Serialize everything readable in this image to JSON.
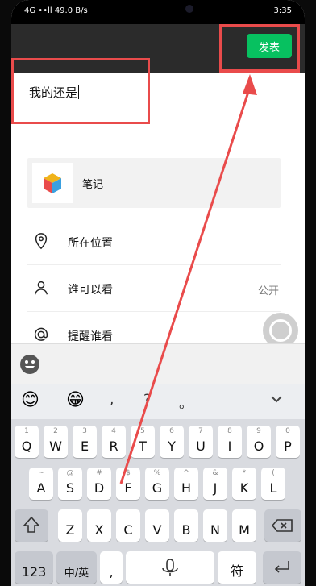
{
  "status": {
    "left": "4G  ••ll  49.0 B/s",
    "right": "3:35"
  },
  "topbar": {
    "post_label": "发表"
  },
  "editor": {
    "text": "我的还是"
  },
  "note": {
    "label": "笔记"
  },
  "options": {
    "location": {
      "label": "所在位置"
    },
    "visibility": {
      "label": "谁可以看",
      "value": "公开"
    },
    "mention": {
      "label": "提醒谁看"
    }
  },
  "keyboard": {
    "top_syms": [
      ",",
      "?",
      "。"
    ],
    "row1": [
      "Q",
      "W",
      "E",
      "R",
      "T",
      "Y",
      "U",
      "I",
      "O",
      "P"
    ],
    "row1_sub": [
      "1",
      "2",
      "3",
      "4",
      "5",
      "6",
      "7",
      "8",
      "9",
      "0"
    ],
    "row2": [
      "A",
      "S",
      "D",
      "F",
      "G",
      "H",
      "J",
      "K",
      "L"
    ],
    "row2_sub": [
      "~",
      "@",
      "#",
      "$",
      "%",
      "^",
      "&",
      "*",
      "("
    ],
    "row3": [
      "Z",
      "X",
      "C",
      "V",
      "B",
      "N",
      "M"
    ],
    "bottom": {
      "num": "123",
      "lang": "中/英",
      "comma": ",",
      "sym": "符"
    }
  },
  "colors": {
    "accent": "#07c160",
    "highlight": "#e94b4b"
  },
  "icons": [
    "pin-icon",
    "person-icon",
    "at-icon",
    "emoji-icon",
    "chevron-down-icon",
    "mic-icon",
    "shift-icon",
    "backspace-icon",
    "return-icon"
  ]
}
